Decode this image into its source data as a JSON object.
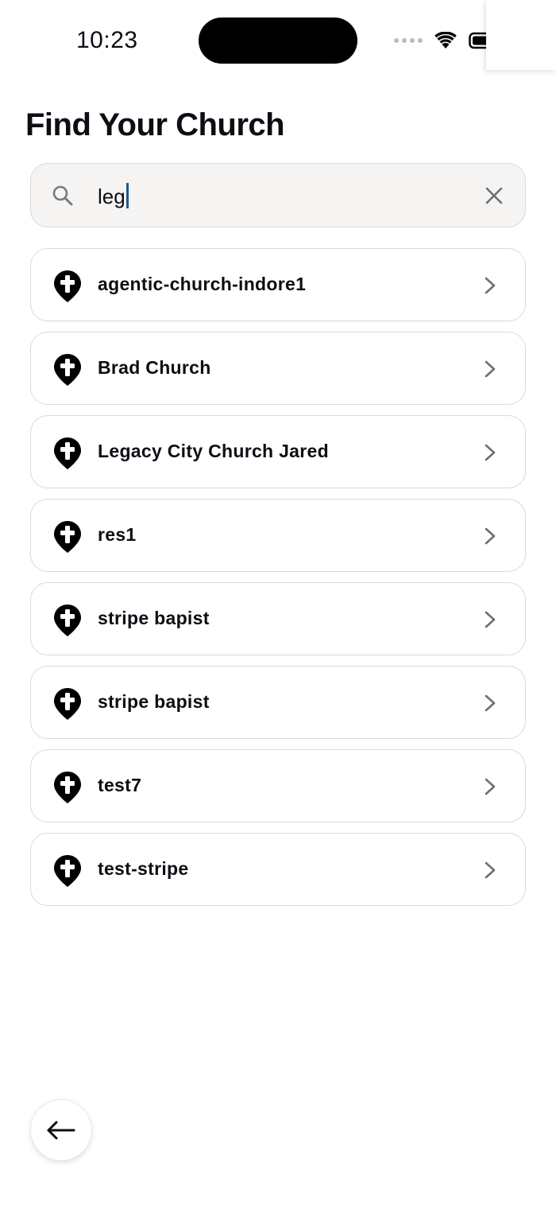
{
  "status_bar": {
    "time": "10:23"
  },
  "page": {
    "title": "Find Your Church"
  },
  "search": {
    "value": "leg",
    "icon": "search-icon",
    "clear_icon": "close-icon"
  },
  "churches": [
    {
      "name": "agentic-church-indore1"
    },
    {
      "name": "Brad Church"
    },
    {
      "name": "Legacy City Church Jared"
    },
    {
      "name": "res1"
    },
    {
      "name": "stripe bapist"
    },
    {
      "name": "stripe bapist"
    },
    {
      "name": "test7"
    },
    {
      "name": "test-stripe"
    }
  ],
  "icons": {
    "church_pin": "church-pin-icon",
    "chevron": "chevron-right-icon",
    "back": "arrow-left-icon"
  },
  "colors": {
    "text": "#0d0d14",
    "search_bg": "#f5f4f3",
    "border": "#d8d9e0",
    "caret": "#1d5a8a"
  }
}
